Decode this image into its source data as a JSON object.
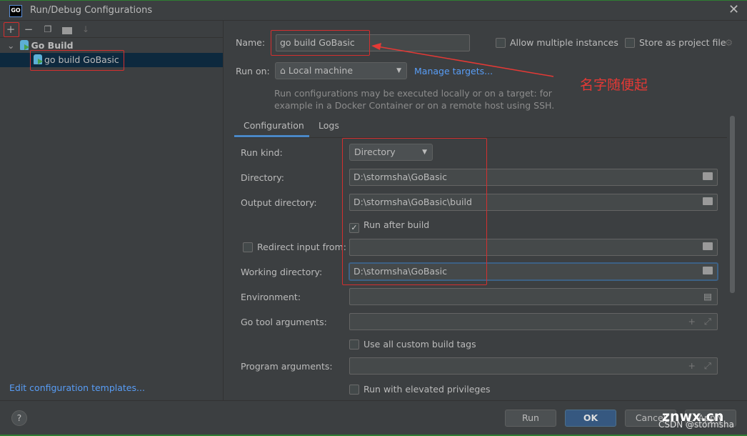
{
  "window": {
    "title": "Run/Debug Configurations",
    "logo": "GO"
  },
  "toolbar": {
    "add": "+",
    "remove": "−",
    "icons": [
      "add-icon",
      "remove-icon",
      "copy-icon",
      "new-folder-icon",
      "sort-icon"
    ]
  },
  "tree": {
    "group": "Go Build",
    "item": "go build GoBasic"
  },
  "left_footer": {
    "templates_link": "Edit configuration templates..."
  },
  "form": {
    "name_label": "Name:",
    "name_value": "go build GoBasic",
    "allow_multiple": "Allow multiple instances",
    "store_project": "Store as project file",
    "run_on_label": "Run on:",
    "run_on_value": "Local machine",
    "manage_targets": "Manage targets...",
    "hint_line1": "Run configurations may be executed locally or on a target: for",
    "hint_line2": "example in a Docker Container or on a remote host using SSH.",
    "tabs": [
      "Configuration",
      "Logs"
    ],
    "run_kind_label": "Run kind:",
    "run_kind_value": "Directory",
    "directory_label": "Directory:",
    "directory_value": "D:\\stormsha\\GoBasic",
    "output_label": "Output directory:",
    "output_value": "D:\\stormsha\\GoBasic\\build",
    "run_after_build": "Run after build",
    "redirect_label": "Redirect input from:",
    "working_label": "Working directory:",
    "working_value": "D:\\stormsha\\GoBasic",
    "environment_label": "Environment:",
    "go_tool_label": "Go tool arguments:",
    "custom_tags": "Use all custom build tags",
    "program_args_label": "Program arguments:",
    "elevated": "Run with elevated privileges"
  },
  "annotation": {
    "text": "名字随便起",
    "color": "#e53935"
  },
  "buttons": {
    "help": "?",
    "run": "Run",
    "ok": "OK",
    "cancel": "Cancel",
    "apply": "Apply"
  },
  "watermark": {
    "line1": "znwx.cn",
    "line2": "CSDN @stormsha"
  }
}
